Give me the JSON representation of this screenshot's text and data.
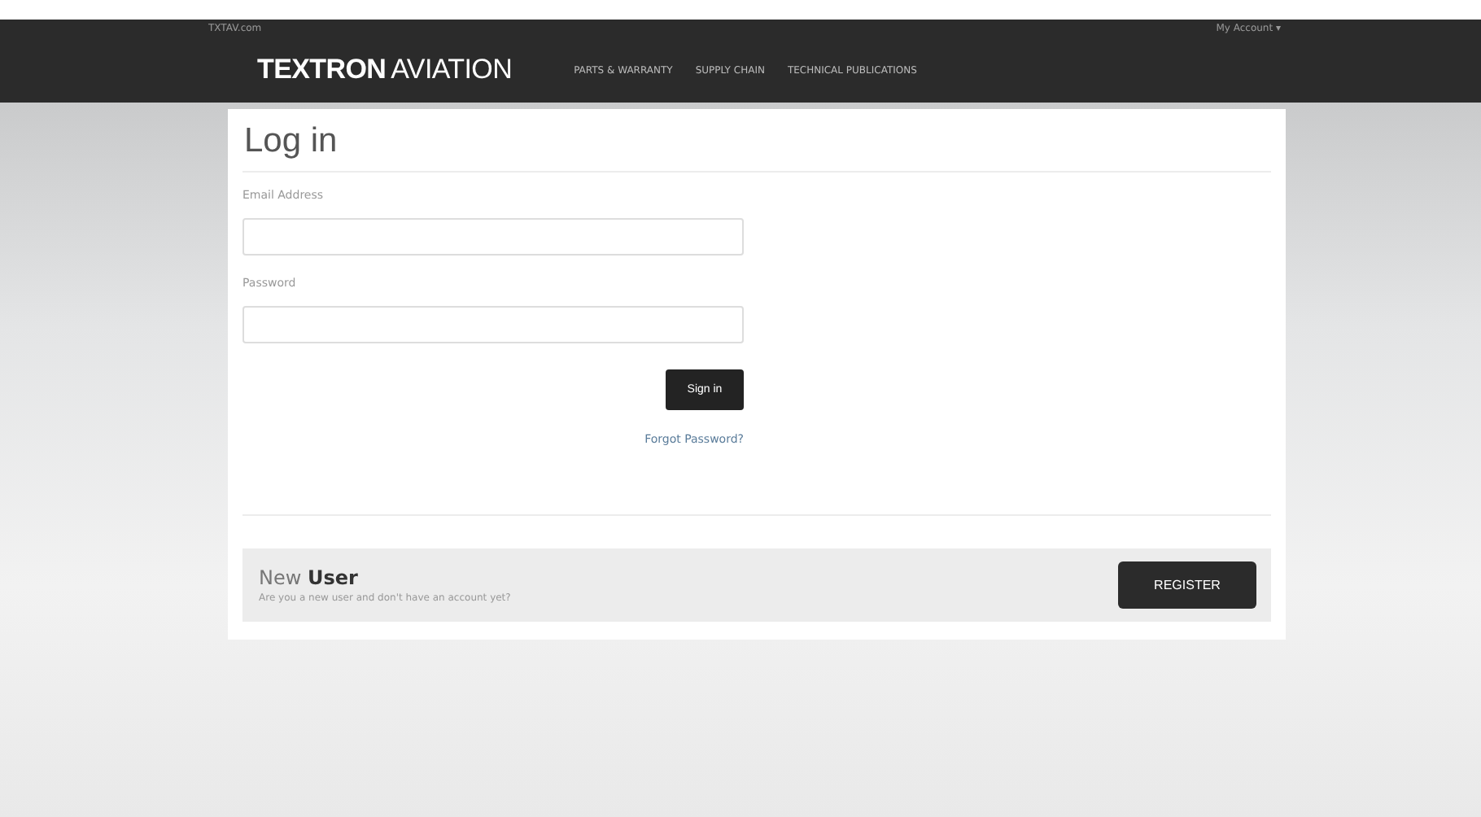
{
  "top_bar": {
    "site_link": "TXTAV.com",
    "account_menu": "My Account ▾"
  },
  "header": {
    "logo_bold": "TEXTRON",
    "logo_light": "AVIATION",
    "nav": [
      "PARTS & WARRANTY",
      "SUPPLY CHAIN",
      "TECHNICAL PUBLICATIONS"
    ]
  },
  "login": {
    "title": "Log in",
    "fields": [
      {
        "label": "Email Address"
      },
      {
        "label": "Password"
      }
    ],
    "submit": "Sign in",
    "forgot_link": "Forgot Password?"
  },
  "register_panel": {
    "heading": "New **User**",
    "text": "Are you a new user and don't have an account yet?",
    "button": "REGISTER"
  }
}
